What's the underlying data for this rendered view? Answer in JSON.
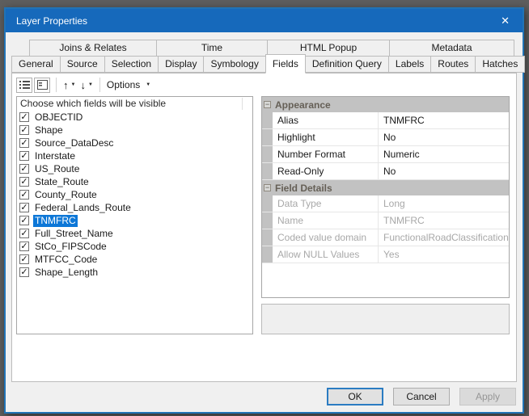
{
  "window": {
    "title": "Layer Properties"
  },
  "icons": {
    "close": "✕",
    "check": "✓",
    "move_up": "↑",
    "move_down": "↓",
    "dropdown": "▼",
    "collapse": "−"
  },
  "tabs": {
    "row1": [
      {
        "label": "Joins & Relates"
      },
      {
        "label": "Time"
      },
      {
        "label": "HTML Popup"
      },
      {
        "label": "Metadata"
      }
    ],
    "row2": [
      {
        "label": "General"
      },
      {
        "label": "Source"
      },
      {
        "label": "Selection"
      },
      {
        "label": "Display"
      },
      {
        "label": "Symbology"
      },
      {
        "label": "Fields",
        "active": true
      },
      {
        "label": "Definition Query"
      },
      {
        "label": "Labels"
      },
      {
        "label": "Routes"
      },
      {
        "label": "Hatches"
      }
    ],
    "active_tab": "Fields"
  },
  "toolbar": {
    "options_label": "Options"
  },
  "fields_panel": {
    "header": "Choose which fields will be visible",
    "selected_field": "TNMFRC",
    "items": [
      {
        "label": "OBJECTID",
        "checked": true
      },
      {
        "label": "Shape",
        "checked": true
      },
      {
        "label": "Source_DataDesc",
        "checked": true
      },
      {
        "label": "Interstate",
        "checked": true
      },
      {
        "label": "US_Route",
        "checked": true
      },
      {
        "label": "State_Route",
        "checked": true
      },
      {
        "label": "County_Route",
        "checked": true
      },
      {
        "label": "Federal_Lands_Route",
        "checked": true
      },
      {
        "label": "TNMFRC",
        "checked": true,
        "selected": true
      },
      {
        "label": "Full_Street_Name",
        "checked": true
      },
      {
        "label": "StCo_FIPSCode",
        "checked": true
      },
      {
        "label": "MTFCC_Code",
        "checked": true
      },
      {
        "label": "Shape_Length",
        "checked": true
      }
    ]
  },
  "properties_panel": {
    "sections": [
      {
        "title": "Appearance",
        "rows": [
          {
            "label": "Alias",
            "value": "TNMFRC"
          },
          {
            "label": "Highlight",
            "value": "No"
          },
          {
            "label": "Number Format",
            "value": "Numeric"
          },
          {
            "label": "Read-Only",
            "value": "No"
          }
        ]
      },
      {
        "title": "Field Details",
        "disabled": true,
        "rows": [
          {
            "label": "Data Type",
            "value": "Long"
          },
          {
            "label": "Name",
            "value": "TNMFRC"
          },
          {
            "label": "Coded value domain",
            "value": "FunctionalRoadClassification"
          },
          {
            "label": "Allow NULL Values",
            "value": "Yes"
          }
        ]
      }
    ]
  },
  "footer": {
    "buttons": [
      {
        "label": "OK",
        "focused": true
      },
      {
        "label": "Cancel"
      },
      {
        "label": "Apply",
        "disabled": true
      }
    ]
  },
  "colors": {
    "titlebar": "#1669bb",
    "selection": "#0d77d7",
    "outer_background": "#5e5e5e",
    "disabled_text": "#a8a8a8"
  }
}
